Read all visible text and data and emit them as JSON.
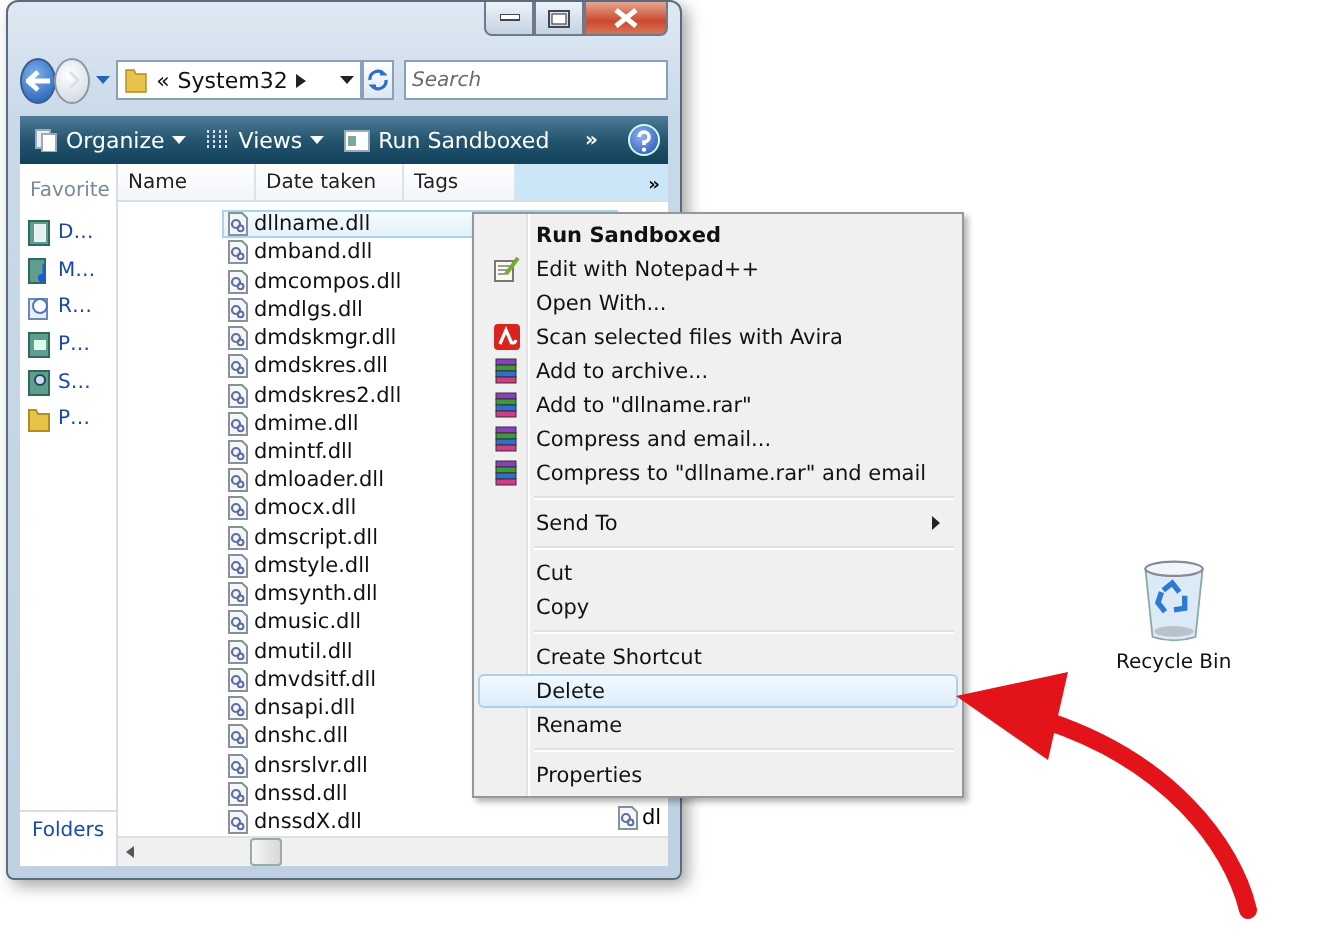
{
  "address": {
    "prefix": "«",
    "path": "System32"
  },
  "search": {
    "placeholder": "Search"
  },
  "toolbar": {
    "items": [
      {
        "label": "Organize",
        "kind": "dropdown"
      },
      {
        "label": "Views",
        "kind": "dropdown"
      },
      {
        "label": "Run Sandboxed",
        "kind": "button"
      }
    ],
    "overflow": "»"
  },
  "columns": {
    "headers": [
      "Name",
      "Date taken",
      "Tags"
    ],
    "overflow": "»"
  },
  "nav": {
    "header": "Favorite",
    "items": [
      {
        "label": "D…"
      },
      {
        "label": "M…"
      },
      {
        "label": "R…"
      },
      {
        "label": "P…"
      },
      {
        "label": "S…"
      },
      {
        "label": "P…"
      }
    ],
    "folders": "Folders"
  },
  "files": [
    {
      "name": "dllname.dll",
      "selected": true
    },
    {
      "name": "dmband.dll",
      "selected": false
    },
    {
      "name": "dmcompos.dll",
      "selected": false
    },
    {
      "name": "dmdlgs.dll",
      "selected": false
    },
    {
      "name": "dmdskmgr.dll",
      "selected": false
    },
    {
      "name": "dmdskres.dll",
      "selected": false
    },
    {
      "name": "dmdskres2.dll",
      "selected": false
    },
    {
      "name": "dmime.dll",
      "selected": false
    },
    {
      "name": "dmintf.dll",
      "selected": false
    },
    {
      "name": "dmloader.dll",
      "selected": false
    },
    {
      "name": "dmocx.dll",
      "selected": false
    },
    {
      "name": "dmscript.dll",
      "selected": false
    },
    {
      "name": "dmstyle.dll",
      "selected": false
    },
    {
      "name": "dmsynth.dll",
      "selected": false
    },
    {
      "name": "dmusic.dll",
      "selected": false
    },
    {
      "name": "dmutil.dll",
      "selected": false
    },
    {
      "name": "dmvdsitf.dll",
      "selected": false
    },
    {
      "name": "dnsapi.dll",
      "selected": false
    },
    {
      "name": "dnshc.dll",
      "selected": false
    },
    {
      "name": "dnsrslvr.dll",
      "selected": false
    },
    {
      "name": "dnssd.dll",
      "selected": false
    },
    {
      "name": "dnssdX.dll",
      "selected": false
    }
  ],
  "next_column_last_file": "dl",
  "context_menu": [
    {
      "kind": "plain",
      "label": "Run Sandboxed",
      "default": true,
      "submenu": false,
      "selected": false
    },
    {
      "kind": "notepad",
      "label": "Edit with Notepad++",
      "default": false,
      "submenu": false,
      "selected": false
    },
    {
      "kind": "plain",
      "label": "Open With...",
      "default": false,
      "submenu": false,
      "selected": false
    },
    {
      "kind": "avira",
      "label": "Scan selected files with Avira",
      "default": false,
      "submenu": false,
      "selected": false
    },
    {
      "kind": "archive",
      "label": "Add to archive...",
      "default": false,
      "submenu": false,
      "selected": false
    },
    {
      "kind": "archive",
      "label": "Add to \"dllname.rar\"",
      "default": false,
      "submenu": false,
      "selected": false
    },
    {
      "kind": "archive",
      "label": "Compress and email...",
      "default": false,
      "submenu": false,
      "selected": false
    },
    {
      "kind": "archive",
      "label": "Compress to \"dllname.rar\" and email",
      "default": false,
      "submenu": false,
      "selected": false
    },
    {
      "kind": "separator"
    },
    {
      "kind": "plain",
      "label": "Send To",
      "default": false,
      "submenu": true,
      "selected": false
    },
    {
      "kind": "separator"
    },
    {
      "kind": "plain",
      "label": "Cut",
      "default": false,
      "submenu": false,
      "selected": false
    },
    {
      "kind": "plain",
      "label": "Copy",
      "default": false,
      "submenu": false,
      "selected": false
    },
    {
      "kind": "separator"
    },
    {
      "kind": "plain",
      "label": "Create Shortcut",
      "default": false,
      "submenu": false,
      "selected": false
    },
    {
      "kind": "plain",
      "label": "Delete",
      "default": false,
      "submenu": false,
      "selected": true
    },
    {
      "kind": "plain",
      "label": "Rename",
      "default": false,
      "submenu": false,
      "selected": false
    },
    {
      "kind": "separator"
    },
    {
      "kind": "plain",
      "label": "Properties",
      "default": false,
      "submenu": false,
      "selected": false
    }
  ],
  "desktop_icon": {
    "label": "Recycle Bin"
  }
}
